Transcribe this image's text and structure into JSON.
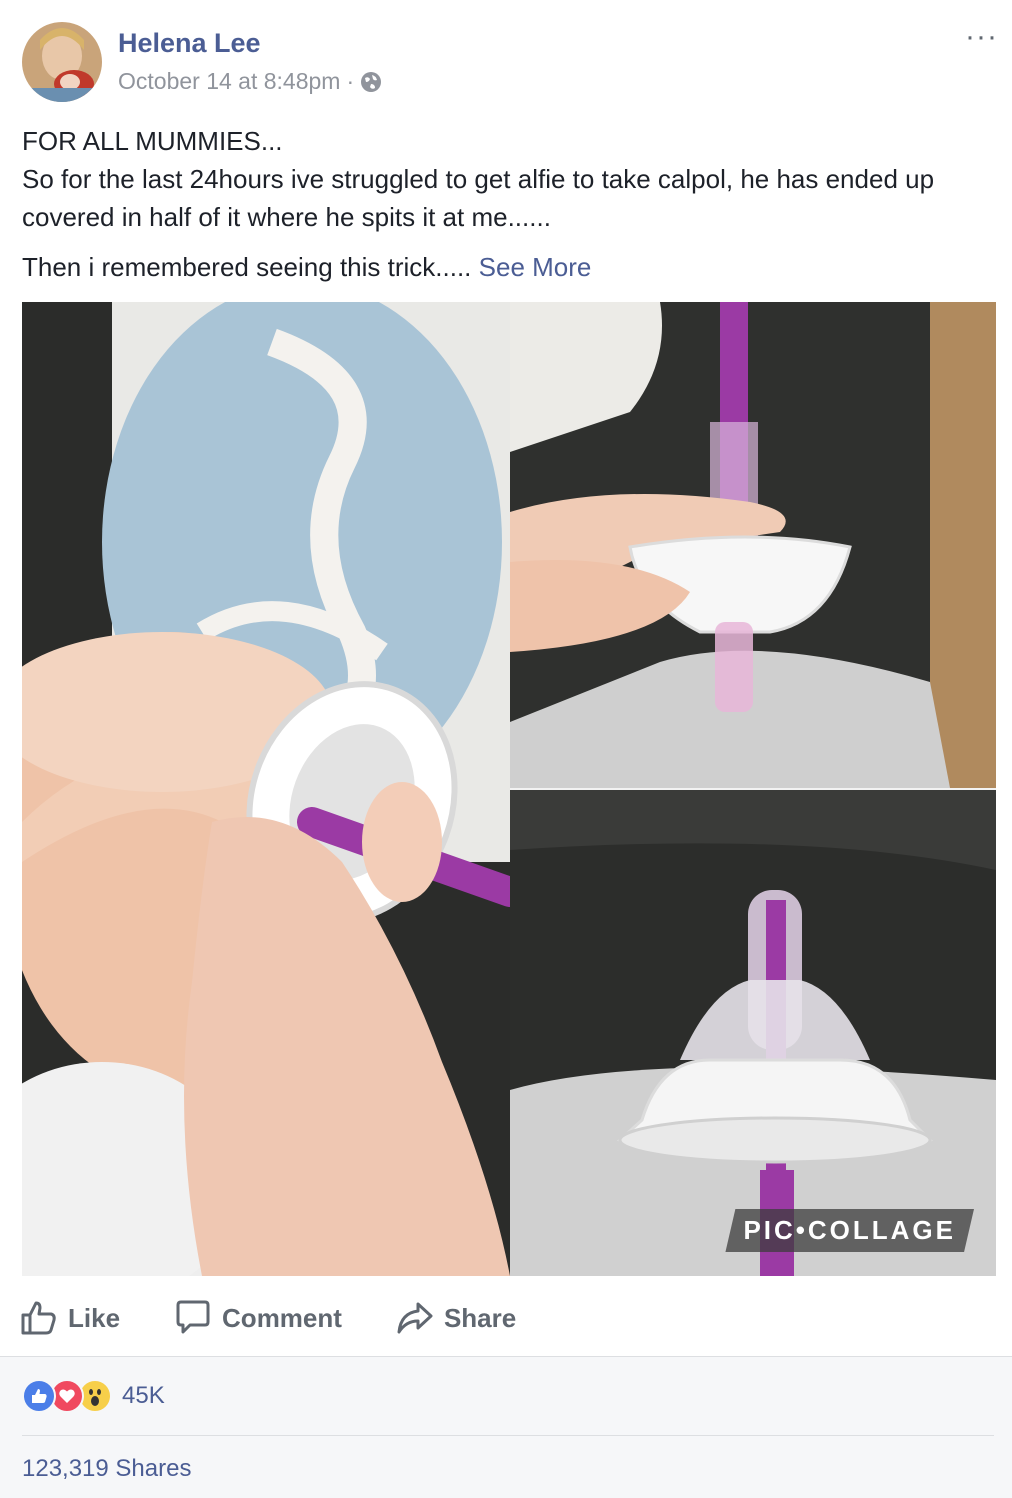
{
  "post": {
    "author": "Helena Lee",
    "timestamp": "October 14 at 8:48pm",
    "separator": "·",
    "privacy_icon": "globe-icon",
    "more_icon": "more-options-icon",
    "more_label": "···",
    "text_lines": [
      "FOR ALL MUMMIES...",
      "So for the last 24hours ive struggled to get alfie to take calpol, he has ended up covered in half of it where he spits it at me......"
    ],
    "text_last": "Then i remembered seeing this trick.....",
    "see_more": "See More"
  },
  "image": {
    "watermark": "PIC•COLLAGE"
  },
  "actions": {
    "like": "Like",
    "comment": "Comment",
    "share": "Share"
  },
  "summary": {
    "reaction_icons": [
      "like-reaction-icon",
      "love-reaction-icon",
      "wow-reaction-icon"
    ],
    "reaction_count": "45K",
    "shares": "123,319 Shares"
  },
  "colors": {
    "link": "#4b5d94",
    "like_blue": "#4b7ee8",
    "love_red": "#f0495f",
    "wow_yellow": "#f7cf4a"
  }
}
